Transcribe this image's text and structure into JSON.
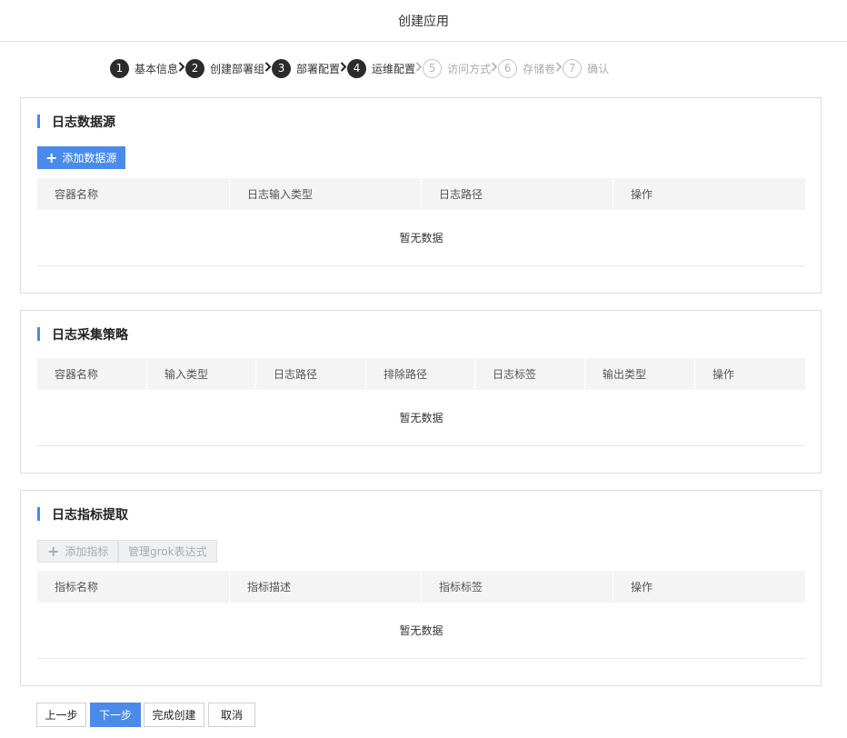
{
  "header": {
    "title": "创建应用"
  },
  "steps": [
    {
      "num": "1",
      "label": "基本信息",
      "state": "done"
    },
    {
      "num": "2",
      "label": "创建部署组",
      "state": "done"
    },
    {
      "num": "3",
      "label": "部署配置",
      "state": "done"
    },
    {
      "num": "4",
      "label": "运维配置",
      "state": "done"
    },
    {
      "num": "5",
      "label": "访问方式",
      "state": "todo"
    },
    {
      "num": "6",
      "label": "存储卷",
      "state": "todo"
    },
    {
      "num": "7",
      "label": "确认",
      "state": "todo"
    }
  ],
  "log_source": {
    "title": "日志数据源",
    "add_button": "添加数据源",
    "columns": [
      "容器名称",
      "日志输入类型",
      "日志路径",
      "操作"
    ],
    "empty": "暂无数据"
  },
  "log_policy": {
    "title": "日志采集策略",
    "columns": [
      "容器名称",
      "输入类型",
      "日志路径",
      "排除路径",
      "日志标签",
      "输出类型",
      "操作"
    ],
    "empty": "暂无数据"
  },
  "log_metric": {
    "title": "日志指标提取",
    "add_button": "添加指标",
    "grok_button": "管理grok表达式",
    "columns": [
      "指标名称",
      "指标描述",
      "指标标签",
      "操作"
    ],
    "empty": "暂无数据"
  },
  "footer": {
    "prev": "上一步",
    "next": "下一步",
    "finish": "完成创建",
    "cancel": "取消"
  },
  "colors": {
    "accent": "#4a8bea",
    "step_done": "#2b2b2b",
    "step_todo": "#b5b5b5"
  }
}
